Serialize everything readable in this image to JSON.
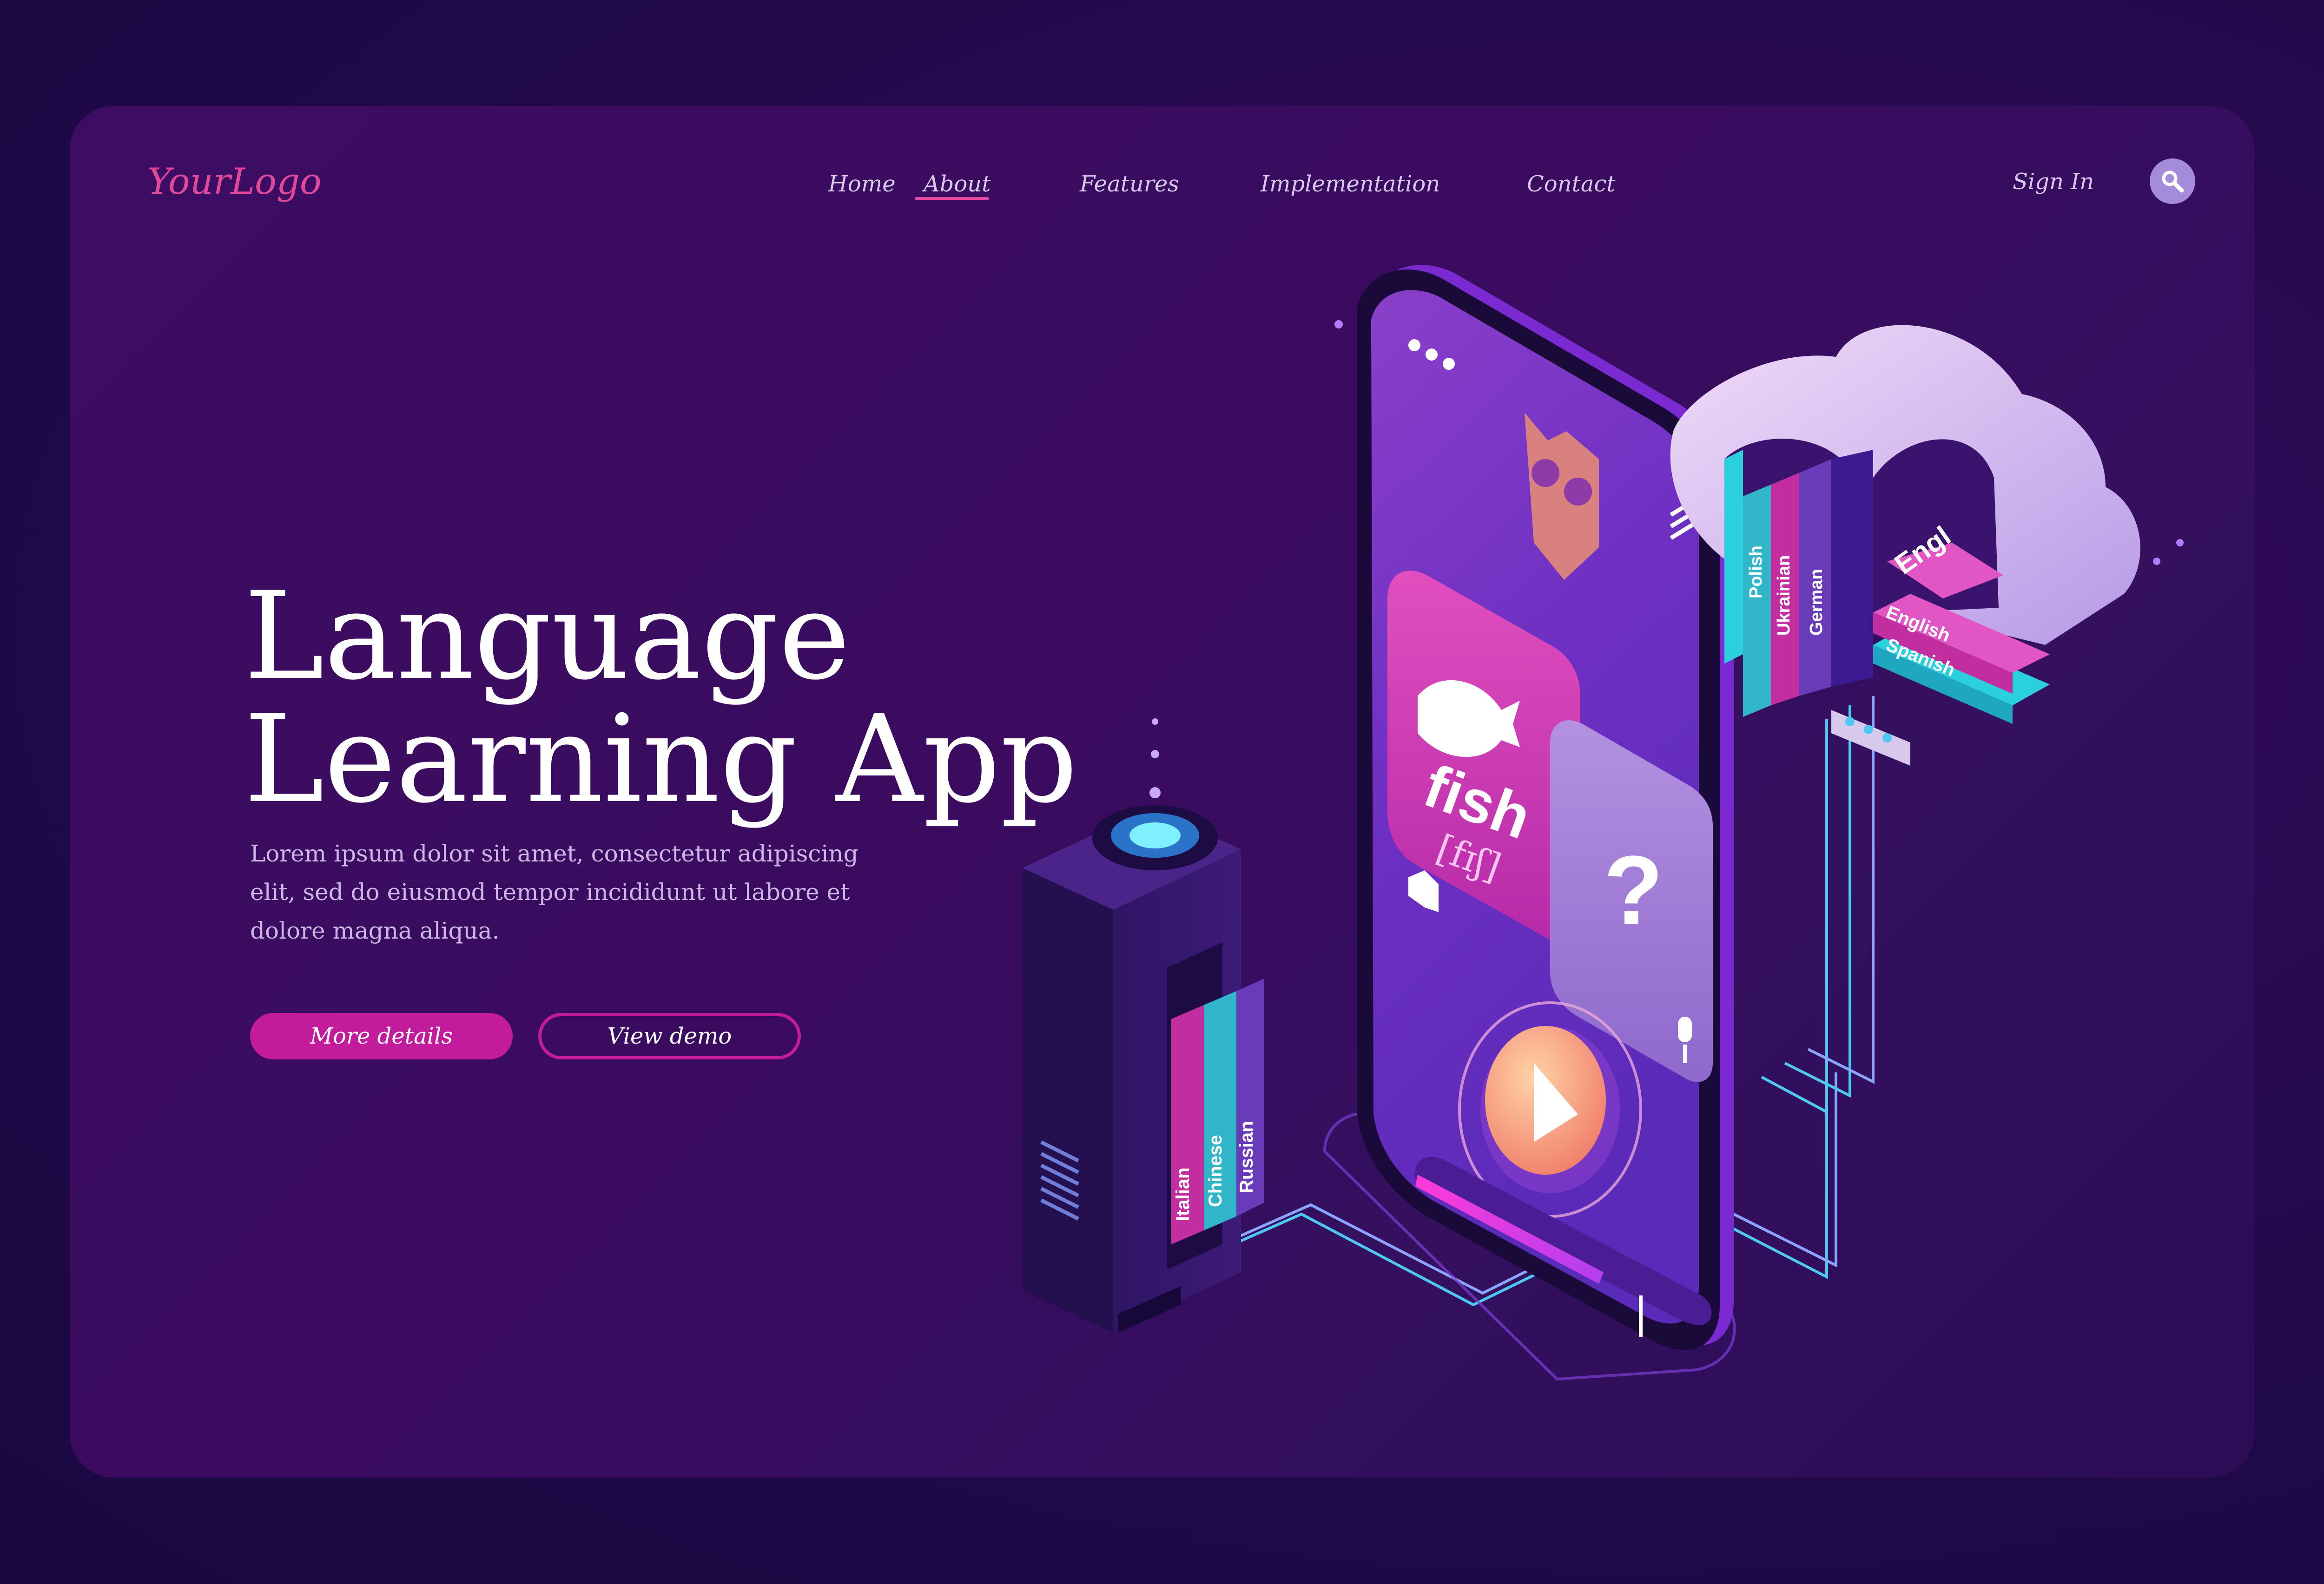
{
  "brand": {
    "logo": "YourLogo"
  },
  "nav": {
    "items": [
      {
        "label": "Home"
      },
      {
        "label": "About"
      },
      {
        "label": "Features"
      },
      {
        "label": "Implementation"
      },
      {
        "label": "Contact"
      }
    ],
    "active": "About",
    "sign_in": "Sign In"
  },
  "hero": {
    "title_line1": "Language",
    "title_line2": "Learning App",
    "description": "Lorem ipsum dolor sit amet, consectetur adipiscing elit, sed do eiusmod tempor incididunt ut labore et dolore magna aliqua.",
    "primary_button": "More details",
    "secondary_button": "View demo"
  },
  "app_screen": {
    "word": "fish",
    "transcription": "[fɪʃ]",
    "question_mark": "?"
  },
  "server_books": [
    "Italian",
    "Chinese",
    "Russian"
  ],
  "cloud_books_vertical": [
    "Polish",
    "Ukrainian",
    "German"
  ],
  "cloud_books_stacked": [
    "Engl",
    "English",
    "Spanish"
  ],
  "colors": {
    "accent": "#e0489b",
    "button": "#c21b9c",
    "background": "#22094a",
    "card": "#3a0b5f"
  },
  "icons": [
    "search-icon",
    "owl-icon",
    "menu-icon",
    "fish-icon",
    "speaker-icon",
    "microphone-icon",
    "play-icon",
    "fan-icon",
    "cloud-icon"
  ]
}
